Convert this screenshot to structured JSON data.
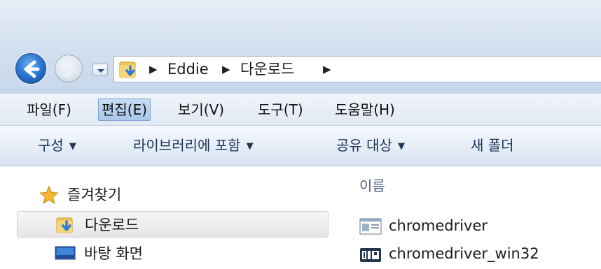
{
  "address": {
    "crumbs": [
      "Eddie",
      "다운로드"
    ]
  },
  "menu": {
    "items": [
      {
        "label": "파일(F)"
      },
      {
        "label": "편집(E)"
      },
      {
        "label": "보기(V)"
      },
      {
        "label": "도구(T)"
      },
      {
        "label": "도움말(H)"
      }
    ],
    "active_index": 1
  },
  "commands": {
    "organize": "구성",
    "include_in_library": "라이브러리에 포함",
    "share_with": "공유 대상",
    "new_folder": "새 폴더"
  },
  "nav_pane": {
    "items": [
      {
        "label": "즐겨찾기",
        "icon": "star-icon"
      },
      {
        "label": "다운로드",
        "icon": "downloads-folder-icon",
        "selected": true
      },
      {
        "label": "바탕 화면",
        "icon": "desktop-icon"
      }
    ]
  },
  "content": {
    "column_name": "이름",
    "files": [
      {
        "name": "chromedriver",
        "icon": "application-icon"
      },
      {
        "name": "chromedriver_win32",
        "icon": "zip-archive-icon"
      }
    ]
  },
  "colors": {
    "menu_active_bg": "#abc8ee",
    "command_text": "#1c3553",
    "nav_back_button": "#2d79d3"
  }
}
